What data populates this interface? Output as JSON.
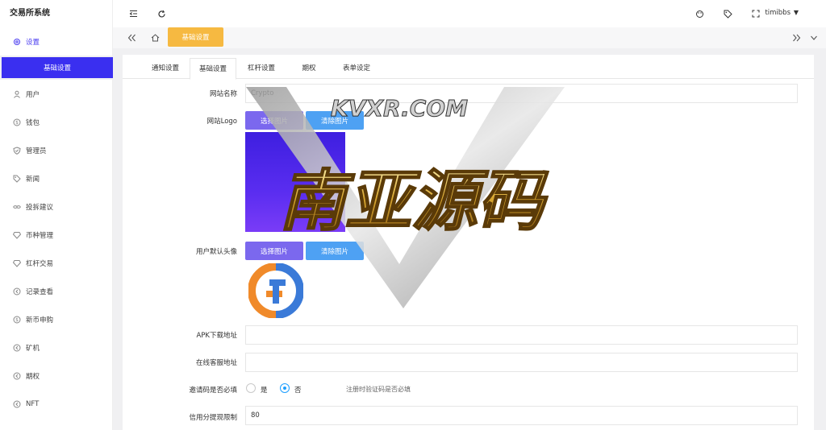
{
  "app": {
    "title": "交易所系统"
  },
  "sidebar": {
    "items": [
      {
        "label": "设置",
        "icon": "gear-icon"
      },
      {
        "label": "用户",
        "icon": "user-icon"
      },
      {
        "label": "钱包",
        "icon": "coin-icon"
      },
      {
        "label": "管理员",
        "icon": "shield-icon"
      },
      {
        "label": "新闻",
        "icon": "tag-icon"
      },
      {
        "label": "投拆建议",
        "icon": "link-icon"
      },
      {
        "label": "币种管理",
        "icon": "diamond-icon"
      },
      {
        "label": "杠杆交易",
        "icon": "diamond-icon"
      },
      {
        "label": "记录查看",
        "icon": "circle-arrow-icon"
      },
      {
        "label": "新币申购",
        "icon": "coin-icon"
      },
      {
        "label": "矿机",
        "icon": "circle-arrow-icon"
      },
      {
        "label": "期权",
        "icon": "circle-arrow-icon"
      },
      {
        "label": "NFT",
        "icon": "circle-arrow-icon"
      }
    ],
    "submenu": {
      "label": "基础设置"
    }
  },
  "topbar": {
    "username": "timibbs"
  },
  "tagbar": {
    "active_tag": "基础设置"
  },
  "tabs": [
    "通知设置",
    "基础设置",
    "杠杆设置",
    "期权",
    "表单设定"
  ],
  "form": {
    "site_name_label": "网站名称",
    "site_name_value": "Crypto",
    "site_logo_label": "网站Logo",
    "select_image": "选择图片",
    "clear_image": "清除图片",
    "avatar_label": "用户默认头像",
    "apk_label": "APK下载地址",
    "apk_value": "",
    "service_label": "在线客服地址",
    "service_value": "",
    "invite_label": "邀请码是否必填",
    "invite_yes": "是",
    "invite_no": "否",
    "invite_selected": "否",
    "invite_hint": "注册时验证码是否必填",
    "credit_label": "信用分提现限制",
    "credit_value": "80"
  },
  "watermark": {
    "domain": "KVXR.COM",
    "text": "南亚源码"
  },
  "colors": {
    "accent": "#3a2ff0",
    "tag": "#f6b941",
    "btn_purple": "#7b68ee",
    "btn_blue": "#4ea1f3"
  }
}
